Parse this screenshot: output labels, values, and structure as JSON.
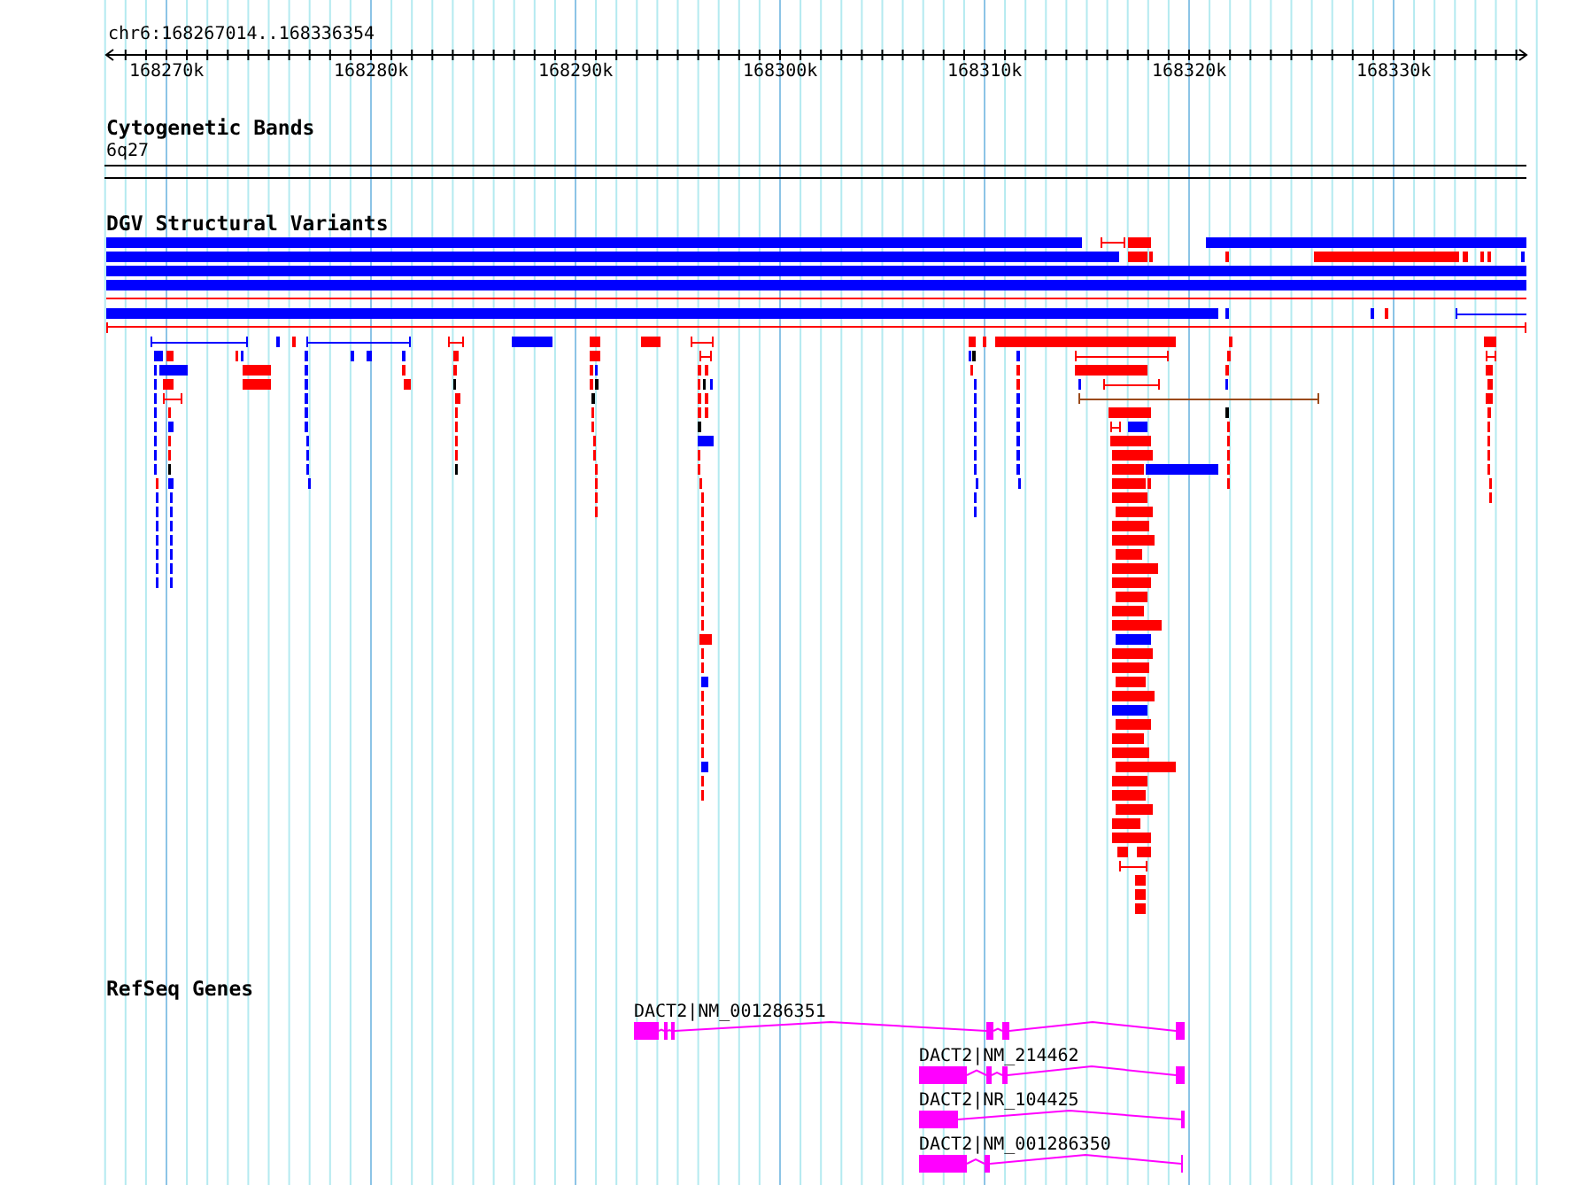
{
  "ruler": {
    "location": "chr6:168267014..168336354",
    "ticks": [
      "168270k",
      "168280k",
      "168290k",
      "168300k",
      "168310k",
      "168320k",
      "168330k"
    ]
  },
  "tracks": [
    {
      "kind": "bands",
      "title": "Cytogenetic Bands",
      "band": "6q27"
    },
    {
      "kind": "variants",
      "title": "DGV Structural Variants"
    },
    {
      "kind": "genes",
      "title": "RefSeq Genes",
      "genes": [
        {
          "label": "DACT2|NM_001286351"
        },
        {
          "label": "DACT2|NM_214462"
        },
        {
          "label": "DACT2|NR_104425"
        },
        {
          "label": "DACT2|NM_001286350"
        }
      ]
    }
  ]
}
